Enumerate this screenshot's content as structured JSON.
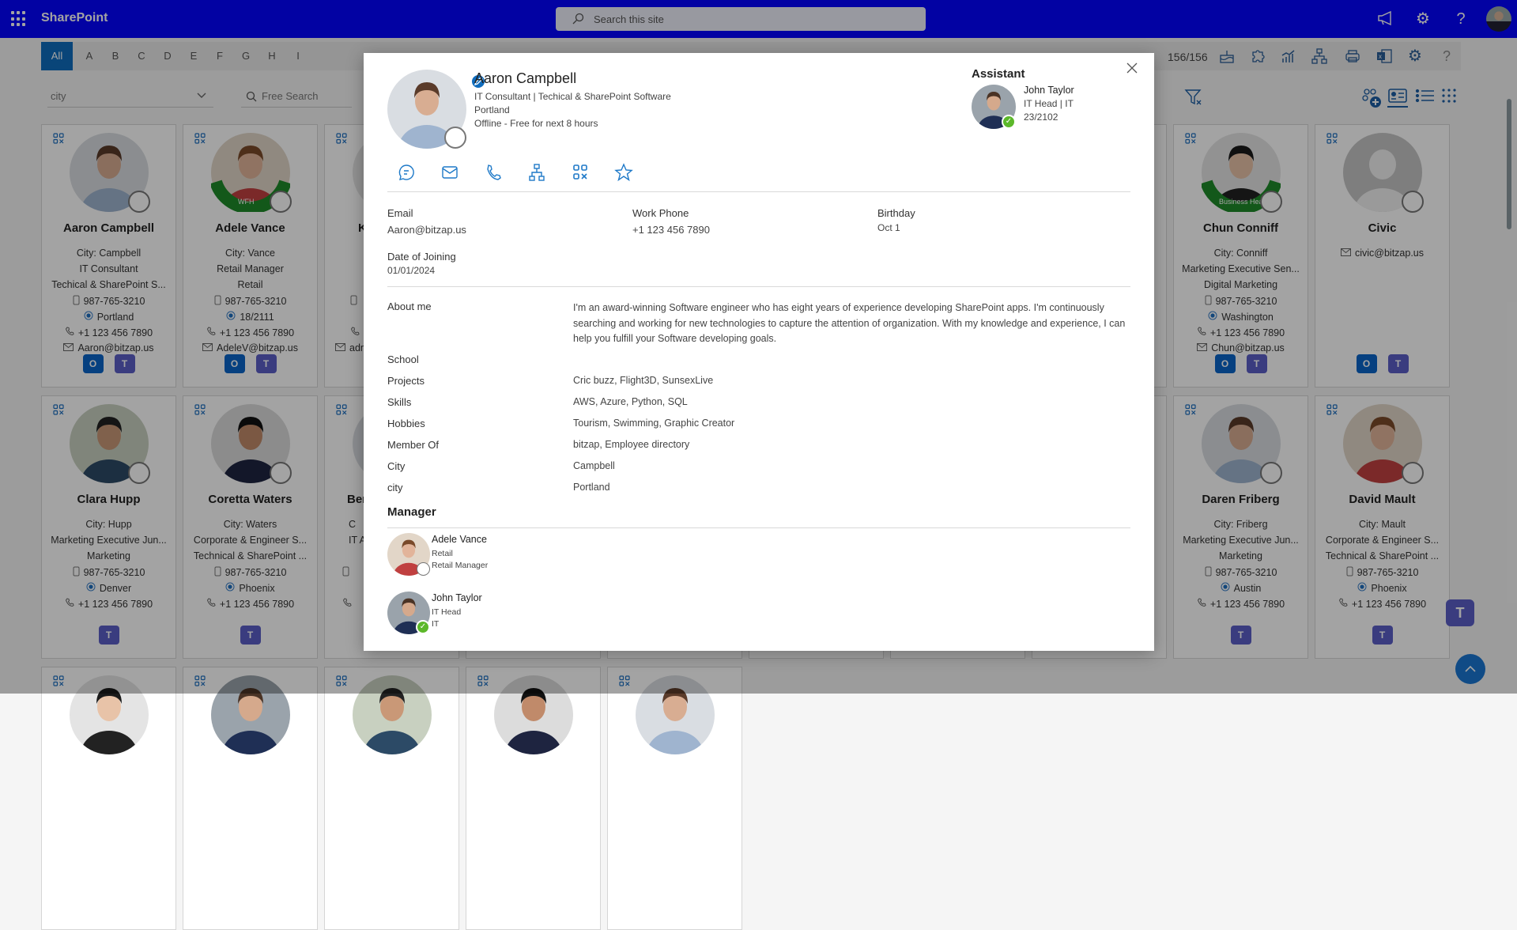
{
  "header": {
    "app_name": "SharePoint",
    "search_placeholder": "Search this site"
  },
  "alphabet": [
    "All",
    "A",
    "B",
    "C",
    "D",
    "E",
    "F",
    "G",
    "H",
    "I"
  ],
  "toolbar": {
    "count": "156/156"
  },
  "filters": {
    "city_select": "city",
    "search_placeholder": "Free Search"
  },
  "cards": [
    {
      "name": "Aaron Campbell",
      "badge": "",
      "lines": [
        {
          "icon": "",
          "text": "City: Campbell"
        },
        {
          "icon": "",
          "text": "IT Consultant"
        },
        {
          "icon": "",
          "text": "Techical & SharePoint S..."
        },
        {
          "icon": "mobile",
          "text": "987-765-3210"
        },
        {
          "icon": "location",
          "text": "Portland"
        },
        {
          "icon": "phone",
          "text": "+1 123 456 7890"
        },
        {
          "icon": "mail",
          "text": "Aaron@bitzap.us"
        }
      ],
      "apps": [
        "outlook",
        "teams"
      ]
    },
    {
      "name": "Adele Vance",
      "badge": "WFH",
      "lines": [
        {
          "icon": "",
          "text": "City: Vance"
        },
        {
          "icon": "",
          "text": "Retail Manager"
        },
        {
          "icon": "",
          "text": "Retail"
        },
        {
          "icon": "mobile",
          "text": "987-765-3210"
        },
        {
          "icon": "location",
          "text": "18/2111"
        },
        {
          "icon": "phone",
          "text": "+1 123 456 7890"
        },
        {
          "icon": "mail",
          "text": "AdeleV@bitzap.us"
        }
      ],
      "apps": [
        "outlook",
        "teams"
      ]
    },
    {
      "name": "K",
      "partial": true,
      "badge": "",
      "lines": [
        {
          "icon": "",
          "text": ""
        },
        {
          "icon": "",
          "text": ""
        },
        {
          "icon": "",
          "text": ""
        },
        {
          "icon": "mobile",
          "text": ""
        },
        {
          "icon": "",
          "text": ""
        },
        {
          "icon": "phone",
          "text": ""
        },
        {
          "icon": "mail",
          "text": "adm"
        }
      ],
      "apps": []
    },
    {
      "hidden": true
    },
    {
      "hidden": true
    },
    {
      "hidden": true
    },
    {
      "hidden": true
    },
    {
      "hidden": true
    },
    {
      "name": "Chun Conniff",
      "badge": "Business Head",
      "lines": [
        {
          "icon": "",
          "text": "City: Conniff"
        },
        {
          "icon": "",
          "text": "Marketing Executive Sen..."
        },
        {
          "icon": "",
          "text": "Digital Marketing"
        },
        {
          "icon": "mobile",
          "text": "987-765-3210"
        },
        {
          "icon": "location",
          "text": "Washington"
        },
        {
          "icon": "phone",
          "text": "+1 123 456 7890"
        },
        {
          "icon": "mail",
          "text": "Chun@bitzap.us"
        }
      ],
      "apps": [
        "outlook",
        "teams"
      ]
    },
    {
      "name": "Civic",
      "default_avatar": true,
      "badge": "",
      "lines": [
        {
          "icon": "mail",
          "text": "civic@bitzap.us"
        }
      ],
      "apps": [
        "outlook",
        "teams"
      ]
    },
    {
      "name": "Clara Hupp",
      "badge": "",
      "lines": [
        {
          "icon": "",
          "text": "City: Hupp"
        },
        {
          "icon": "",
          "text": "Marketing Executive Jun..."
        },
        {
          "icon": "",
          "text": "Marketing"
        },
        {
          "icon": "mobile",
          "text": "987-765-3210"
        },
        {
          "icon": "location",
          "text": "Denver"
        },
        {
          "icon": "phone",
          "text": "+1 123 456 7890"
        }
      ],
      "apps": [
        "teams"
      ]
    },
    {
      "name": "Coretta Waters",
      "badge": "",
      "lines": [
        {
          "icon": "",
          "text": "City: Waters"
        },
        {
          "icon": "",
          "text": "Corporate & Engineer S..."
        },
        {
          "icon": "",
          "text": "Technical & SharePoint ..."
        },
        {
          "icon": "mobile",
          "text": "987-765-3210"
        },
        {
          "icon": "location",
          "text": "Phoenix"
        },
        {
          "icon": "phone",
          "text": "+1 123 456 7890"
        }
      ],
      "apps": [
        "teams"
      ]
    },
    {
      "name": "Ber",
      "partial": true,
      "badge": "",
      "lines": [
        {
          "icon": "",
          "text": "C"
        },
        {
          "icon": "",
          "text": "IT Ana"
        },
        {
          "icon": "",
          "text": ""
        },
        {
          "icon": "mobile",
          "text": ""
        },
        {
          "icon": "",
          "text": ""
        },
        {
          "icon": "phone",
          "text": ""
        }
      ],
      "apps": []
    },
    {
      "hidden": true
    },
    {
      "hidden": true
    },
    {
      "hidden": true
    },
    {
      "hidden": true
    },
    {
      "hidden": true
    },
    {
      "name": "Daren Friberg",
      "badge": "",
      "lines": [
        {
          "icon": "",
          "text": "City: Friberg"
        },
        {
          "icon": "",
          "text": "Marketing Executive Jun..."
        },
        {
          "icon": "",
          "text": "Marketing"
        },
        {
          "icon": "mobile",
          "text": "987-765-3210"
        },
        {
          "icon": "location",
          "text": "Austin"
        },
        {
          "icon": "phone",
          "text": "+1 123 456 7890"
        }
      ],
      "apps": [
        "teams"
      ]
    },
    {
      "name": "David Mault",
      "badge": "",
      "lines": [
        {
          "icon": "",
          "text": "City: Mault"
        },
        {
          "icon": "",
          "text": "Corporate & Engineer S..."
        },
        {
          "icon": "",
          "text": "Technical & SharePoint ..."
        },
        {
          "icon": "mobile",
          "text": "987-765-3210"
        },
        {
          "icon": "location",
          "text": "Phoenix"
        },
        {
          "icon": "phone",
          "text": "+1 123 456 7890"
        }
      ],
      "apps": [
        "teams"
      ]
    },
    {
      "stub": true
    },
    {
      "stub": true
    },
    {
      "stub": true
    },
    {
      "stub": true
    },
    {
      "stub": true
    }
  ],
  "modal": {
    "name": "Aaron Campbell",
    "subtitle": "IT Consultant | Techical  & SharePoint Software",
    "location": "Portland",
    "presence": "Offline - Free for next 8 hours",
    "assistant": {
      "heading": "Assistant",
      "name": "John Taylor",
      "title": "IT Head | IT",
      "office": "23/2102"
    },
    "contact": [
      {
        "label": "Email",
        "value": "Aaron@bitzap.us"
      },
      {
        "label": "Work Phone",
        "value": "+1 123 456 7890"
      },
      {
        "label": "Birthday",
        "value": "Oct 1"
      },
      {
        "label": "Date of Joining",
        "value": "01/01/2024"
      }
    ],
    "about_label": "About me",
    "about": "I'm an award-winning Software engineer who has eight years of experience developing SharePoint apps. I'm continuously searching and working for new technologies to capture the attention of organization. With my knowledge and experience, I can help you fulfill your Software developing goals.",
    "details": [
      {
        "label": "School",
        "value": ""
      },
      {
        "label": "Projects",
        "value": "Cric buzz, Flight3D, SunsexLive"
      },
      {
        "label": "Skills",
        "value": "AWS, Azure, Python, SQL"
      },
      {
        "label": "Hobbies",
        "value": "Tourism, Swimming, Graphic Creator"
      },
      {
        "label": "Member Of",
        "value": "bitzap, Employee directory"
      },
      {
        "label": "City",
        "value": "Campbell"
      },
      {
        "label": "city",
        "value": "Portland"
      }
    ],
    "manager_heading": "Manager",
    "managers": [
      {
        "name": "Adele Vance",
        "line1": "Retail",
        "line2": "Retail Manager",
        "status": "offline"
      },
      {
        "name": "John Taylor",
        "line1": "IT Head",
        "line2": "IT",
        "status": "available"
      }
    ]
  }
}
